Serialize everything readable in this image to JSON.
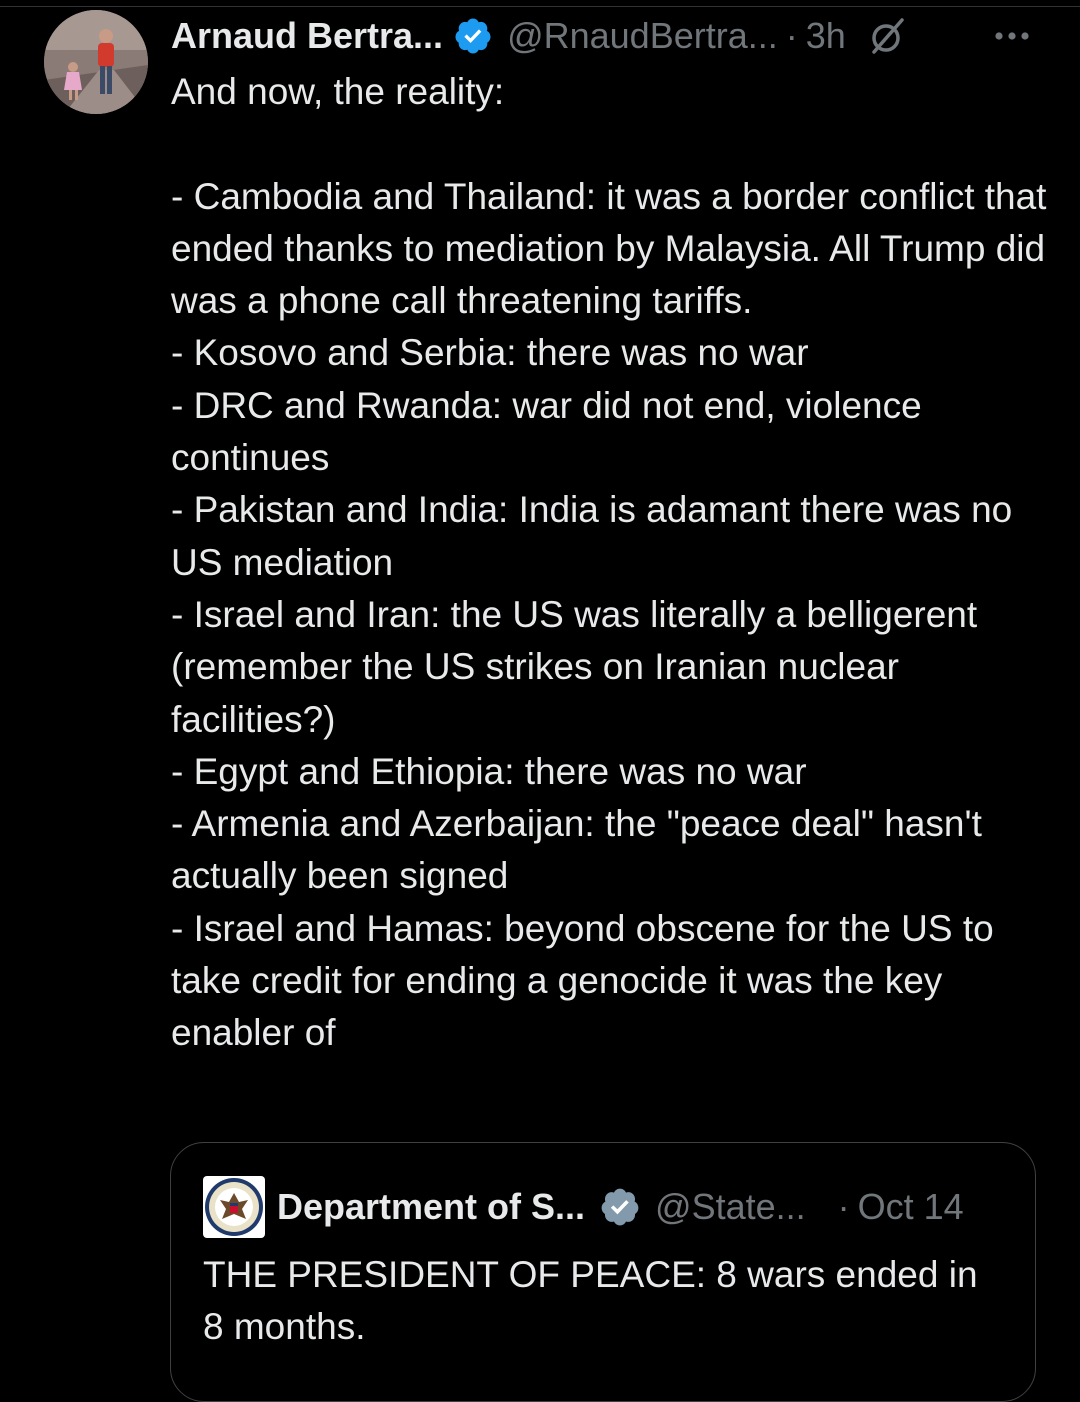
{
  "colors": {
    "background": "#000000",
    "text_primary": "#e7e9ea",
    "text_secondary": "#71767b",
    "verified_blue": "#1d9bf0",
    "verified_gray": "#829aab",
    "border": "#3e4144"
  },
  "tweet": {
    "author": {
      "display_name": "Arnaud Bertra...",
      "handle": "@RnaudBertra...",
      "verified_badge": "verified-blue-icon",
      "avatar": "user-avatar-photo"
    },
    "separator": "·",
    "time": "3h",
    "grok_icon": "grok-icon",
    "more_icon": "more-dots-icon",
    "text_lines": [
      "And now, the reality:",
      "",
      "- Cambodia and Thailand: it was a border conflict that ended thanks to mediation by Malaysia. All Trump did was a phone call threatening tariffs.",
      "- Kosovo and Serbia: there was no war",
      "- DRC and Rwanda: war did not end, violence continues",
      "- Pakistan and India: India is adamant there was no US mediation",
      "- Israel and Iran: the US was literally a belligerent (remember the US strikes on Iranian nuclear facilities?)",
      "- Egypt and Ethiopia: there was no war",
      "- Armenia and Azerbaijan: the \"peace deal\" hasn't actually been signed",
      "- Israel and Hamas: beyond obscene for the US to take credit for ending a genocide it was the key enabler of"
    ]
  },
  "quoted_tweet": {
    "author": {
      "display_name": "Department of S...",
      "handle": "@State...",
      "verified_badge": "verified-gray-icon",
      "avatar": "state-department-seal"
    },
    "separator": "·",
    "time": "Oct 14",
    "text": "THE PRESIDENT OF PEACE: 8 wars ended in 8 months."
  }
}
